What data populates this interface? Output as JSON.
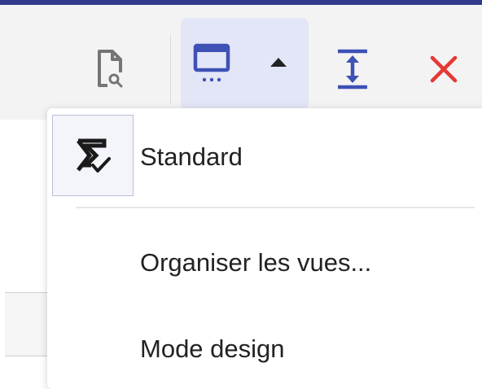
{
  "toolbar": {
    "accent_color": "#303a8c",
    "buttons": [
      {
        "icon": "document-search-icon"
      },
      {
        "icon": "view-window-icon"
      },
      {
        "icon": "dropdown-arrow-icon"
      },
      {
        "icon": "fit-height-icon"
      },
      {
        "icon": "close-icon"
      }
    ]
  },
  "view_menu": {
    "items": [
      {
        "label": "Standard",
        "icon": "sigma-check-icon",
        "selected": true
      },
      {
        "label": "Organiser les vues..."
      },
      {
        "label": "Mode design"
      }
    ]
  },
  "colors": {
    "icon_gray": "#757575",
    "icon_blue": "#3f51b5",
    "close_red": "#e53935",
    "active_bg": "#e3e6f7"
  }
}
